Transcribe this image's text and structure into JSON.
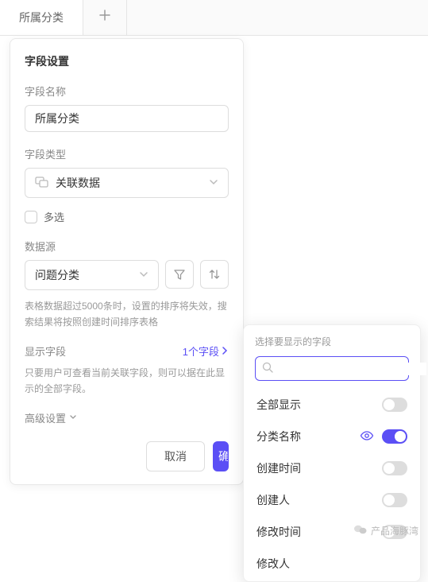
{
  "tab": {
    "label": "所属分类"
  },
  "panel": {
    "title": "字段设置",
    "name_label": "字段名称",
    "name_value": "所属分类",
    "type_label": "字段类型",
    "type_value": "关联数据",
    "multi_label": "多选",
    "ds_label": "数据源",
    "ds_value": "问题分类",
    "ds_hint": "表格数据超过5000条时，设置的排序将失效，搜索结果将按照创建时间排序表格",
    "display_label": "显示字段",
    "display_link": "1个字段",
    "display_hint": "只要用户可查看当前关联字段，则可以据在此显示的全部字段。",
    "advanced_label": "高级设置",
    "cancel": "取消",
    "confirm": "确"
  },
  "popover": {
    "title": "选择要显示的字段",
    "search_value": "",
    "items": [
      {
        "label": "全部显示",
        "on": false,
        "eye": false
      },
      {
        "label": "分类名称",
        "on": true,
        "eye": true
      },
      {
        "label": "创建时间",
        "on": false,
        "eye": false
      },
      {
        "label": "创建人",
        "on": false,
        "eye": false
      },
      {
        "label": "修改时间",
        "on": false,
        "eye": false
      },
      {
        "label": "修改人",
        "on": false,
        "eye": false
      }
    ]
  },
  "watermark": "产品海豚湾"
}
